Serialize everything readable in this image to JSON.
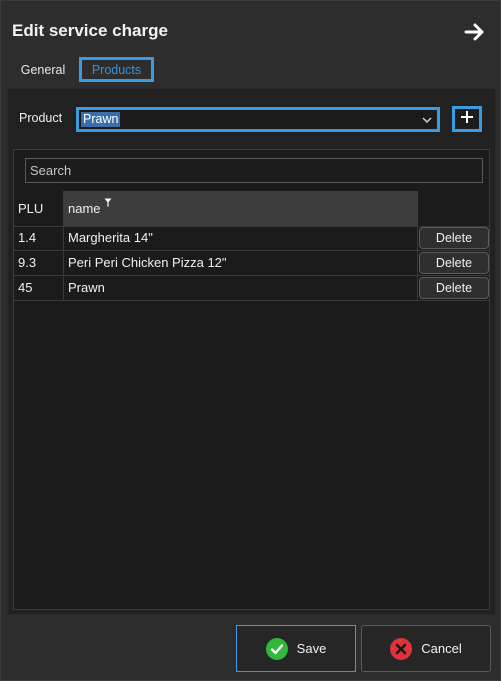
{
  "dialog": {
    "title": "Edit service charge"
  },
  "tabs": [
    {
      "label": "General",
      "active": false
    },
    {
      "label": "Products",
      "active": true
    }
  ],
  "product_picker": {
    "label": "Product",
    "selected": "Prawn",
    "add_icon": "plus-icon",
    "chevron_icon": "chevron-down-icon"
  },
  "grid": {
    "search_placeholder": "Search",
    "columns": [
      "PLU",
      "name"
    ],
    "rows": [
      {
        "plu": "1.4",
        "name": "Margherita 14\"",
        "action": "Delete"
      },
      {
        "plu": "9.3",
        "name": "Peri Peri Chicken Pizza 12\"",
        "action": "Delete"
      },
      {
        "plu": "45",
        "name": "Prawn",
        "action": "Delete"
      }
    ]
  },
  "footer": {
    "save_label": "Save",
    "cancel_label": "Cancel",
    "save_icon": "check-circle-icon",
    "cancel_icon": "close-circle-icon"
  },
  "colors": {
    "accent": "#3a9be0",
    "background": "#2d2d2d",
    "panel": "#212121",
    "save_green": "#2fb83a",
    "cancel_red": "#e0343a"
  }
}
